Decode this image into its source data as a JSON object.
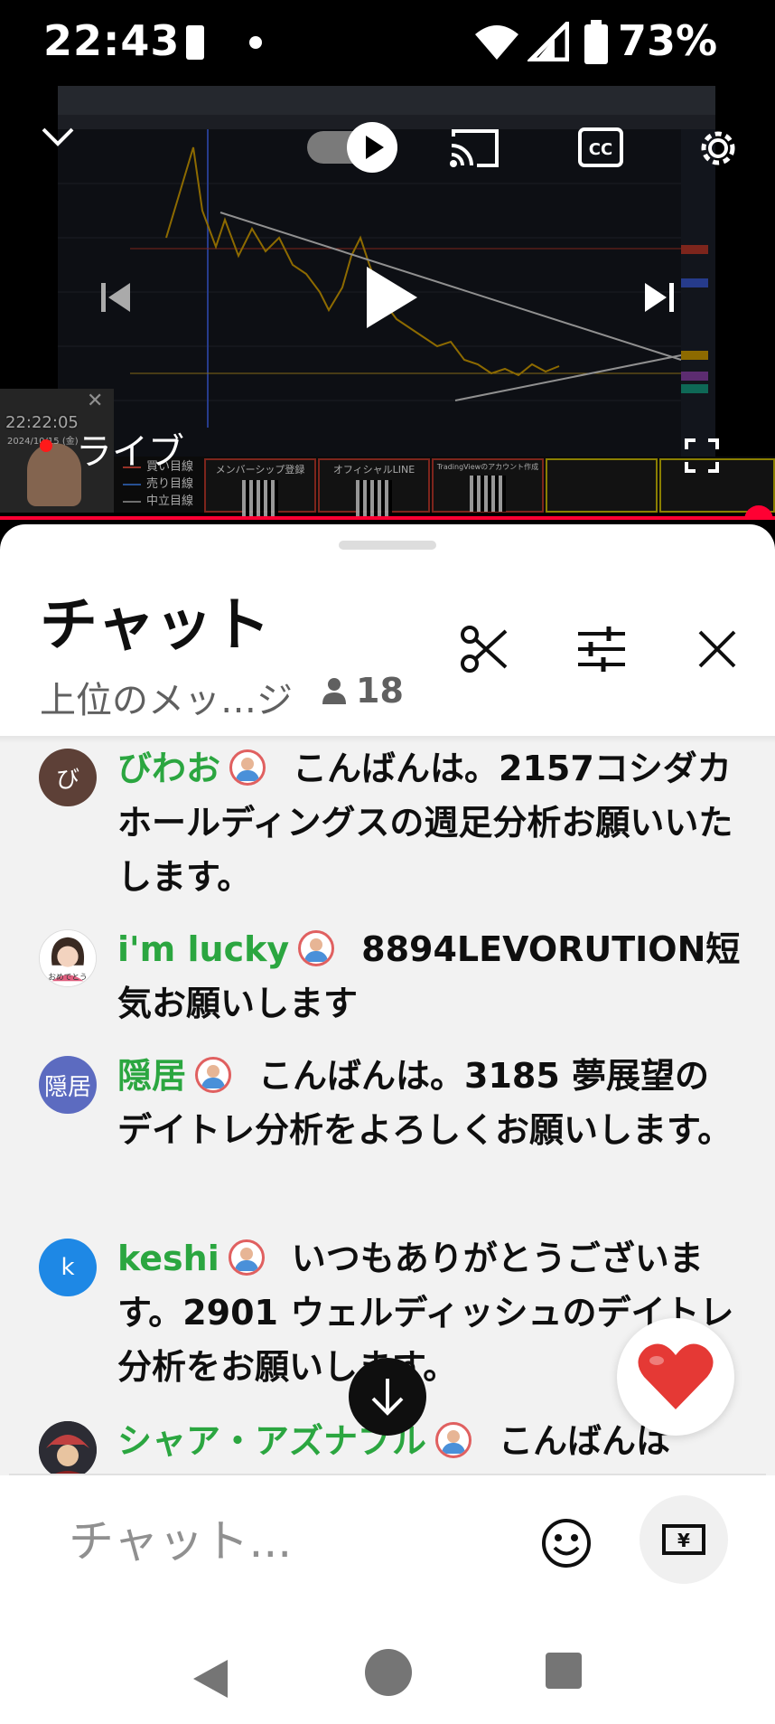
{
  "status_bar": {
    "time": "22:43",
    "battery_percent": "73%",
    "icons": [
      "sim-icon",
      "notification-dot-icon",
      "wifi-icon",
      "signal-icon",
      "battery-icon"
    ]
  },
  "video": {
    "live_label": "ライブ",
    "pip_time": "22:22:05",
    "pip_date": "2024/10/15 (金)",
    "legend": [
      "買い目線",
      "売り目線",
      "中立目線"
    ],
    "promo_cards": [
      "メンバーシップ登録",
      "オフィシャルLINE",
      "TradingViewのアカウント作成"
    ],
    "progress": 1.0,
    "colors": {
      "progress": "#ff0033",
      "live_dot": "#ff1a1a"
    }
  },
  "chat": {
    "title": "チャット",
    "mode_label": "上位のメッ…ジ",
    "viewer_count": "18",
    "messages": [
      {
        "author": "びわお",
        "avatar_text": "び",
        "avatar_color": "#5d4037",
        "text": "こんばんは。2157コシダカホールディングスの週足分析お願いいたします。"
      },
      {
        "author": "i'm lucky",
        "avatar_text": "",
        "avatar_color": "#ffffff",
        "text": "8894LEVORUTION短気お願いします"
      },
      {
        "author": "隠居",
        "avatar_text": "隠居",
        "avatar_color": "#5c6bc0",
        "text": "こんばんは。3185 夢展望のデイトレ分析をよろしくお願いします。"
      },
      {
        "author": "keshi",
        "avatar_text": "k",
        "avatar_color": "#1e88e5",
        "text": "いつもありがとうございます。2901 ウェルディッシュのデイトレ分析をお願いします。"
      },
      {
        "author": "シャア・アズナブル",
        "avatar_text": "",
        "avatar_color": "#3a3a3a",
        "text": "こんばんは"
      }
    ],
    "input_placeholder": "チャット...",
    "colors": {
      "author": "#2ba640",
      "heart": "#e53935"
    }
  }
}
